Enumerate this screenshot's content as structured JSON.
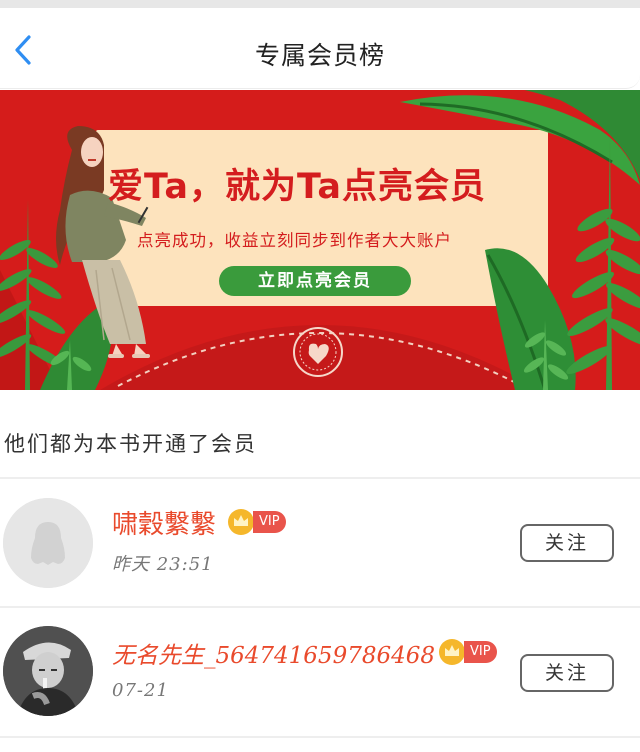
{
  "nav": {
    "title": "专属会员榜"
  },
  "banner": {
    "headline": "爱Ta，就为Ta点亮会员",
    "subline": "点亮成功，收益立刻同步到作者大大账户",
    "cta": "立即点亮会员"
  },
  "section": {
    "title": "他们都为本书开通了会员"
  },
  "members": [
    {
      "name": "啸穀繫繫",
      "badge": "VIP",
      "time": "昨天 23:51",
      "follow": "关注",
      "avatar": "default-penguin-avatar"
    },
    {
      "name": "无名先生_564741659786468",
      "badge": "VIP",
      "time": "07-21",
      "follow": "关注",
      "avatar": "child-photo-avatar"
    }
  ],
  "colors": {
    "banner_red": "#d51c1b",
    "card_cream": "#fde3bd",
    "cta_green": "#3a9b3c",
    "name_orange": "#e94a2c",
    "vip_red": "#e9544b",
    "crown_gold": "#f5b72b",
    "back_blue": "#2f8ef2"
  }
}
